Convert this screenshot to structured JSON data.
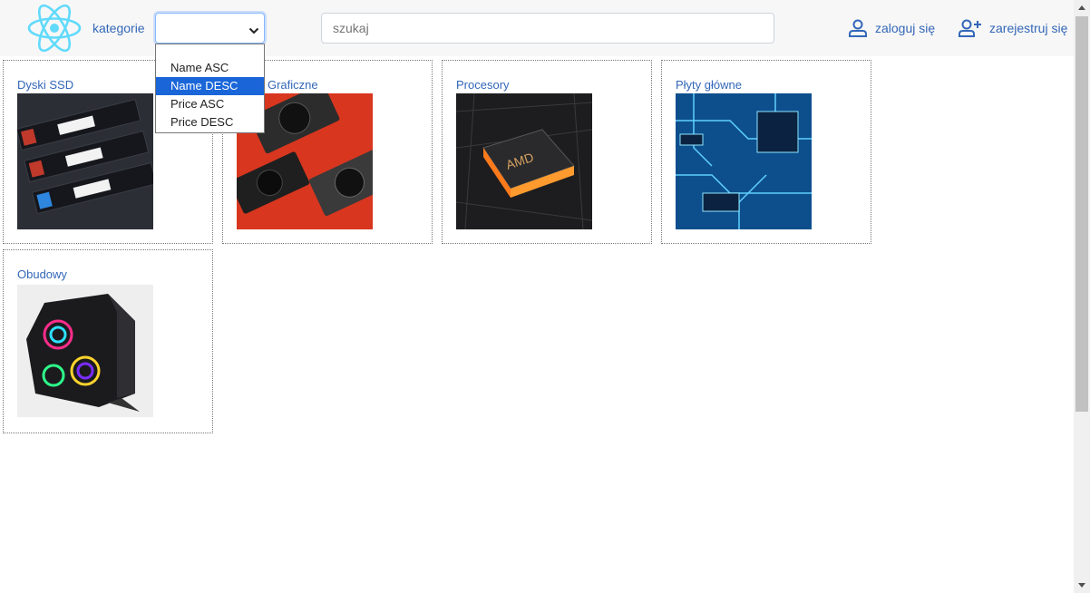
{
  "header": {
    "logo_icon": "react-logo-icon",
    "kategorie_label": "kategorie",
    "sort_select": {
      "value": "",
      "options": [
        "",
        "Name ASC",
        "Name DESC",
        "Price ASC",
        "Price DESC"
      ],
      "highlighted": "Name DESC"
    },
    "search": {
      "placeholder": "szukaj",
      "value": ""
    },
    "login_label": "zaloguj się",
    "login_icon": "user-icon",
    "register_label": "zarejestruj się",
    "register_icon": "user-plus-icon",
    "link_color": "#3367b8"
  },
  "categories": [
    {
      "name": "Dyski SSD",
      "image": "ssd-image"
    },
    {
      "name": "Karty Graficzne",
      "image": "gpu-image"
    },
    {
      "name": "Procesory",
      "image": "cpu-image"
    },
    {
      "name": "Płyty główne",
      "image": "motherboard-image"
    },
    {
      "name": "Obudowy",
      "image": "pc-case-image"
    }
  ]
}
